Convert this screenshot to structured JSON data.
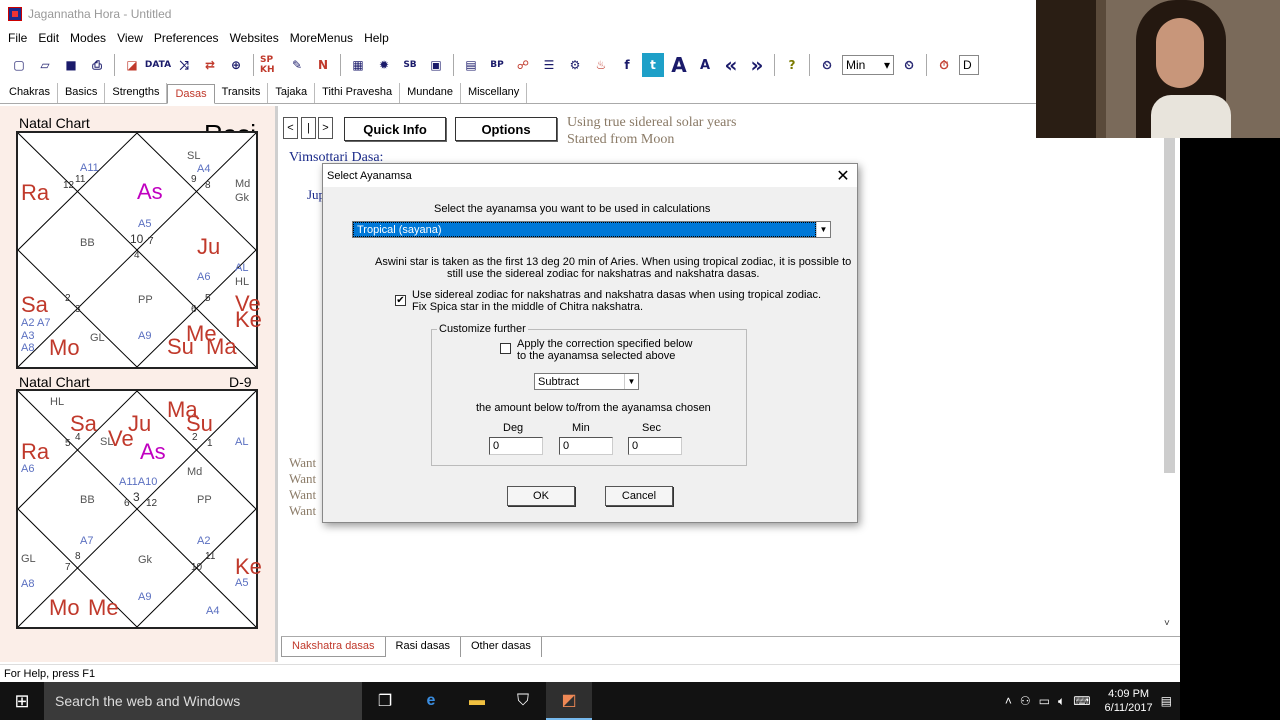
{
  "window": {
    "title": "Jagannatha Hora - Untitled"
  },
  "menu": [
    "File",
    "Edit",
    "Modes",
    "View",
    "Preferences",
    "Websites",
    "MoreMenus",
    "Help"
  ],
  "toolbar": {
    "items": [
      "new-icon",
      "open-icon",
      "save-icon",
      "print-icon",
      "chart-icon",
      "data-icon",
      "sp-kh-icon",
      "n-icon",
      "grid-icon",
      "sb-icon",
      "bp-icon",
      "people-icon",
      "book-icon",
      "fire-icon",
      "facebook-icon",
      "twitter-icon",
      "font-large-icon",
      "font-small-icon",
      "back-icon",
      "forward-icon",
      "help-icon"
    ],
    "data_label": "DATA",
    "spkh_label": "SP KH",
    "n_label": "N",
    "sb_label": "SB",
    "bp_label": "BP",
    "font_large": "A",
    "font_small": "A",
    "facebook": "f",
    "twitter": "t",
    "help": "?",
    "back": "«",
    "forward": "»",
    "unit_select": "Min",
    "extra": "D"
  },
  "tabs": [
    "Chakras",
    "Basics",
    "Strengths",
    "Dasas",
    "Transits",
    "Tajaka",
    "Tithi Pravesha",
    "Mundane",
    "Miscellany"
  ],
  "active_tab": "Dasas",
  "left": {
    "chart1": {
      "label": "Natal Chart",
      "name": "Rasi",
      "glyphs": {
        "Ra": "Ra",
        "As": "As",
        "A11": "A11",
        "SL": "SL",
        "A4": "A4",
        "Md": "Md",
        "Gk": "Gk",
        "n12": "12",
        "n11": "11",
        "n9": "9",
        "n8": "8",
        "A5": "A5",
        "BB": "BB",
        "n10": "10",
        "n7": "7",
        "n4": "4",
        "Ju": "Ju",
        "A6": "A6",
        "AL": "AL",
        "HL": "HL",
        "PP": "PP",
        "Sa": "Sa",
        "n2": "2",
        "n3": "3",
        "n6": "6",
        "n5": "5",
        "Ve": "Ve",
        "Ke": "Ke",
        "A2": "A2",
        "A7": "A7",
        "A3": "A3",
        "A8": "A8",
        "Mo": "Mo",
        "GL": "GL",
        "A9": "A9",
        "Su": "Su",
        "Me": "Me",
        "Ma": "Ma"
      }
    },
    "chart2": {
      "label": "Natal Chart",
      "name": "D-9",
      "glyphs": {
        "HL": "HL",
        "Ra": "Ra",
        "A6": "A6",
        "Sa": "Sa",
        "Ve": "Ve",
        "SL": "SL",
        "Ju": "Ju",
        "As": "As",
        "Ma": "Ma",
        "Su": "Su",
        "AL": "AL",
        "n5": "5",
        "n4": "4",
        "n2": "2",
        "n1": "1",
        "A11A10": "A11A10",
        "Md": "Md",
        "BB": "BB",
        "n3": "3",
        "n6": "6",
        "n12": "12",
        "PP": "PP",
        "A7": "A7",
        "A2": "A2",
        "GL": "GL",
        "A8": "A8",
        "n7": "7",
        "n8": "8",
        "Gk": "Gk",
        "n10": "10",
        "n11": "11",
        "Ke": "Ke",
        "A5": "A5",
        "Mo": "Mo",
        "Me": "Me",
        "A9": "A9",
        "A4": "A4"
      }
    }
  },
  "dasa": {
    "quick_info": "Quick Info",
    "options": "Options",
    "info1": "Using true sidereal solar years",
    "info2": "Started from Moon",
    "heading": "Vimsottari Dasa:",
    "row_partial": "Jup",
    "want_lines": [
      "Want",
      "Want",
      "Want",
      "Want"
    ],
    "nav": {
      "prev": "<",
      "pipe": "|",
      "next": ">"
    }
  },
  "bottom_tabs": [
    "Nakshatra dasas",
    "Rasi dasas",
    "Other dasas"
  ],
  "status": "For Help, press F1",
  "dialog": {
    "title": "Select Ayanamsa",
    "prompt": "Select the ayanamsa you want to be used in calculations",
    "ayanamsa_value": "Tropical (sayana)",
    "desc1": "Aswini star is taken as the first 13 deg 20 min of Aries. When using tropical zodiac, it is possible to",
    "desc2": "still use the sidereal zodiac  for nakshatras and nakshatra dasas.",
    "check1_line1": "Use sidereal zodiac for nakshatras and nakshatra dasas when using tropical zodiac.",
    "check1_line2": "Fix Spica star in the middle of Chitra nakshatra.",
    "check1_checked": true,
    "group_label": "Customize further",
    "check2_line1": "Apply the correction specified below",
    "check2_line2": "to the ayanamsa selected above",
    "check2_checked": false,
    "op_value": "Subtract",
    "amount_label": "the amount below to/from the ayanamsa chosen",
    "deg_label": "Deg",
    "min_label": "Min",
    "sec_label": "Sec",
    "deg": "0",
    "min": "0",
    "sec": "0",
    "ok": "OK",
    "cancel": "Cancel"
  },
  "taskbar": {
    "search_placeholder": "Search the web and Windows",
    "time": "4:09 PM",
    "date": "6/11/2017"
  }
}
